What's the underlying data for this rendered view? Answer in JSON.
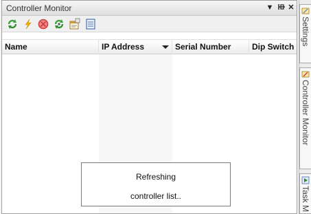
{
  "panel": {
    "title": "Controller Monitor",
    "controls": {
      "dropdown_glyph": "▼",
      "pin_glyph": "⊣",
      "close_glyph": "✕"
    }
  },
  "toolbar": {
    "buttons": [
      {
        "name": "refresh-icon",
        "color": "#3aa33a"
      },
      {
        "name": "lightning-icon",
        "color": "#f0b400"
      },
      {
        "name": "stop-icon",
        "color": "#e04040"
      },
      {
        "name": "sync-icon",
        "color": "#3aa33a"
      },
      {
        "name": "properties-icon",
        "color": "#c89a3a"
      },
      {
        "name": "list-icon",
        "color": "#4a6fb0"
      }
    ]
  },
  "grid": {
    "columns": [
      "Name",
      "IP Address",
      "Serial Number",
      "Dip Switch"
    ],
    "sorted_column": "IP Address",
    "rows": []
  },
  "side_tabs": [
    {
      "label": "Settings",
      "icon": "settings-icon"
    },
    {
      "label": "Controller Monitor",
      "icon": "controller-icon"
    },
    {
      "label": "Task M",
      "icon": "task-icon"
    }
  ],
  "overlay": {
    "line1": "Refreshing",
    "line2": "controller list.."
  }
}
